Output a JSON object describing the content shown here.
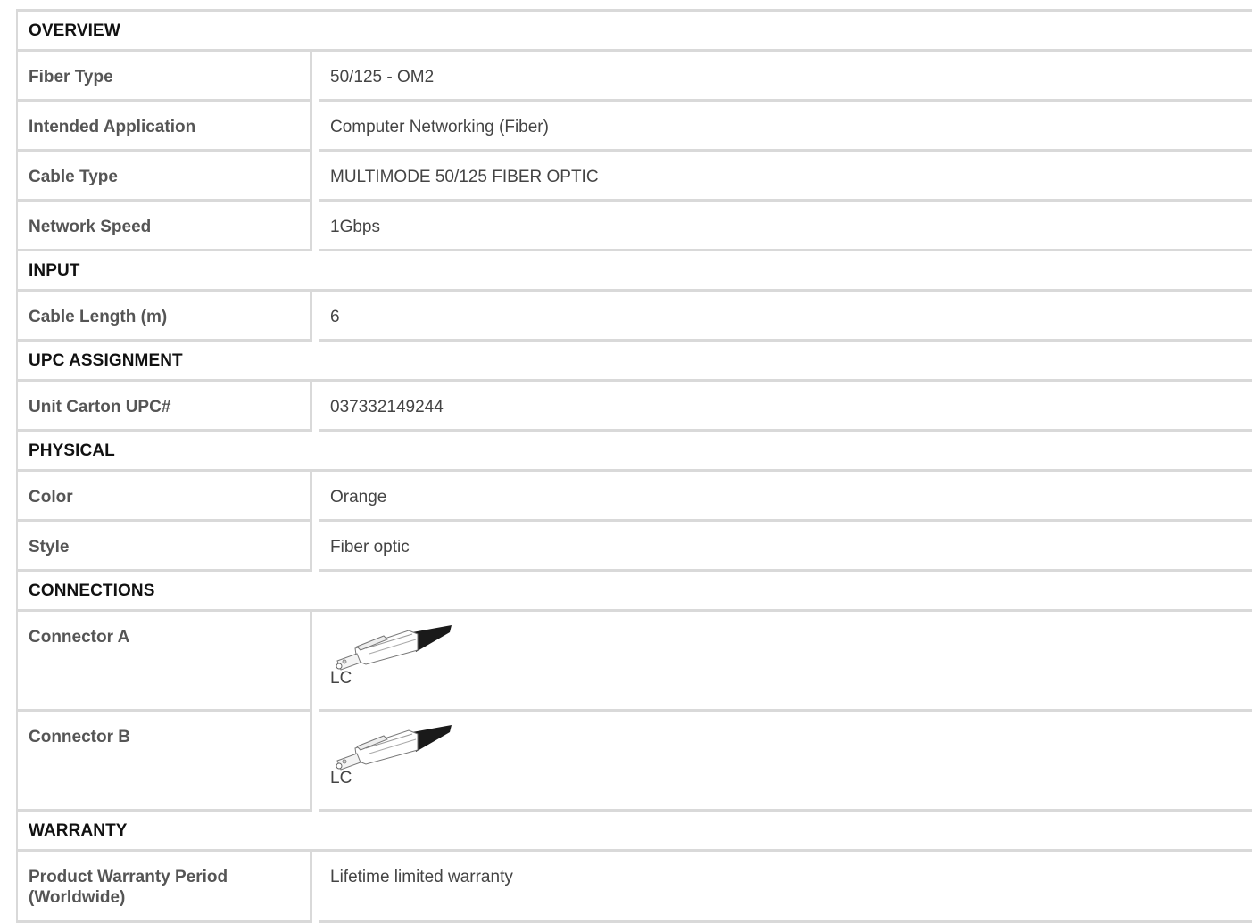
{
  "sections": [
    {
      "title": "OVERVIEW",
      "rows": [
        {
          "label": "Fiber Type",
          "value": "50/125 - OM2"
        },
        {
          "label": "Intended Application",
          "value": "Computer Networking (Fiber)"
        },
        {
          "label": "Cable Type",
          "value": "MULTIMODE 50/125 FIBER OPTIC"
        },
        {
          "label": "Network Speed",
          "value": "1Gbps"
        }
      ]
    },
    {
      "title": "INPUT",
      "rows": [
        {
          "label": "Cable Length (m)",
          "value": "6"
        }
      ]
    },
    {
      "title": "UPC ASSIGNMENT",
      "rows": [
        {
          "label": "Unit Carton UPC#",
          "value": "037332149244"
        }
      ]
    },
    {
      "title": "PHYSICAL",
      "rows": [
        {
          "label": "Color",
          "value": "Orange"
        },
        {
          "label": "Style",
          "value": "Fiber optic"
        }
      ]
    },
    {
      "title": "CONNECTIONS",
      "rows": [
        {
          "label": "Connector A",
          "value": "LC",
          "icon": "lc-connector-icon"
        },
        {
          "label": "Connector B",
          "value": "LC",
          "icon": "lc-connector-icon"
        }
      ]
    },
    {
      "title": "WARRANTY",
      "rows": [
        {
          "label": "Product Warranty Period (Worldwide)",
          "value": "Lifetime limited warranty"
        }
      ]
    }
  ],
  "colors": {
    "border": "#d9d9d9",
    "header_text": "#111111",
    "label_text": "#555555",
    "value_text": "#444444"
  }
}
